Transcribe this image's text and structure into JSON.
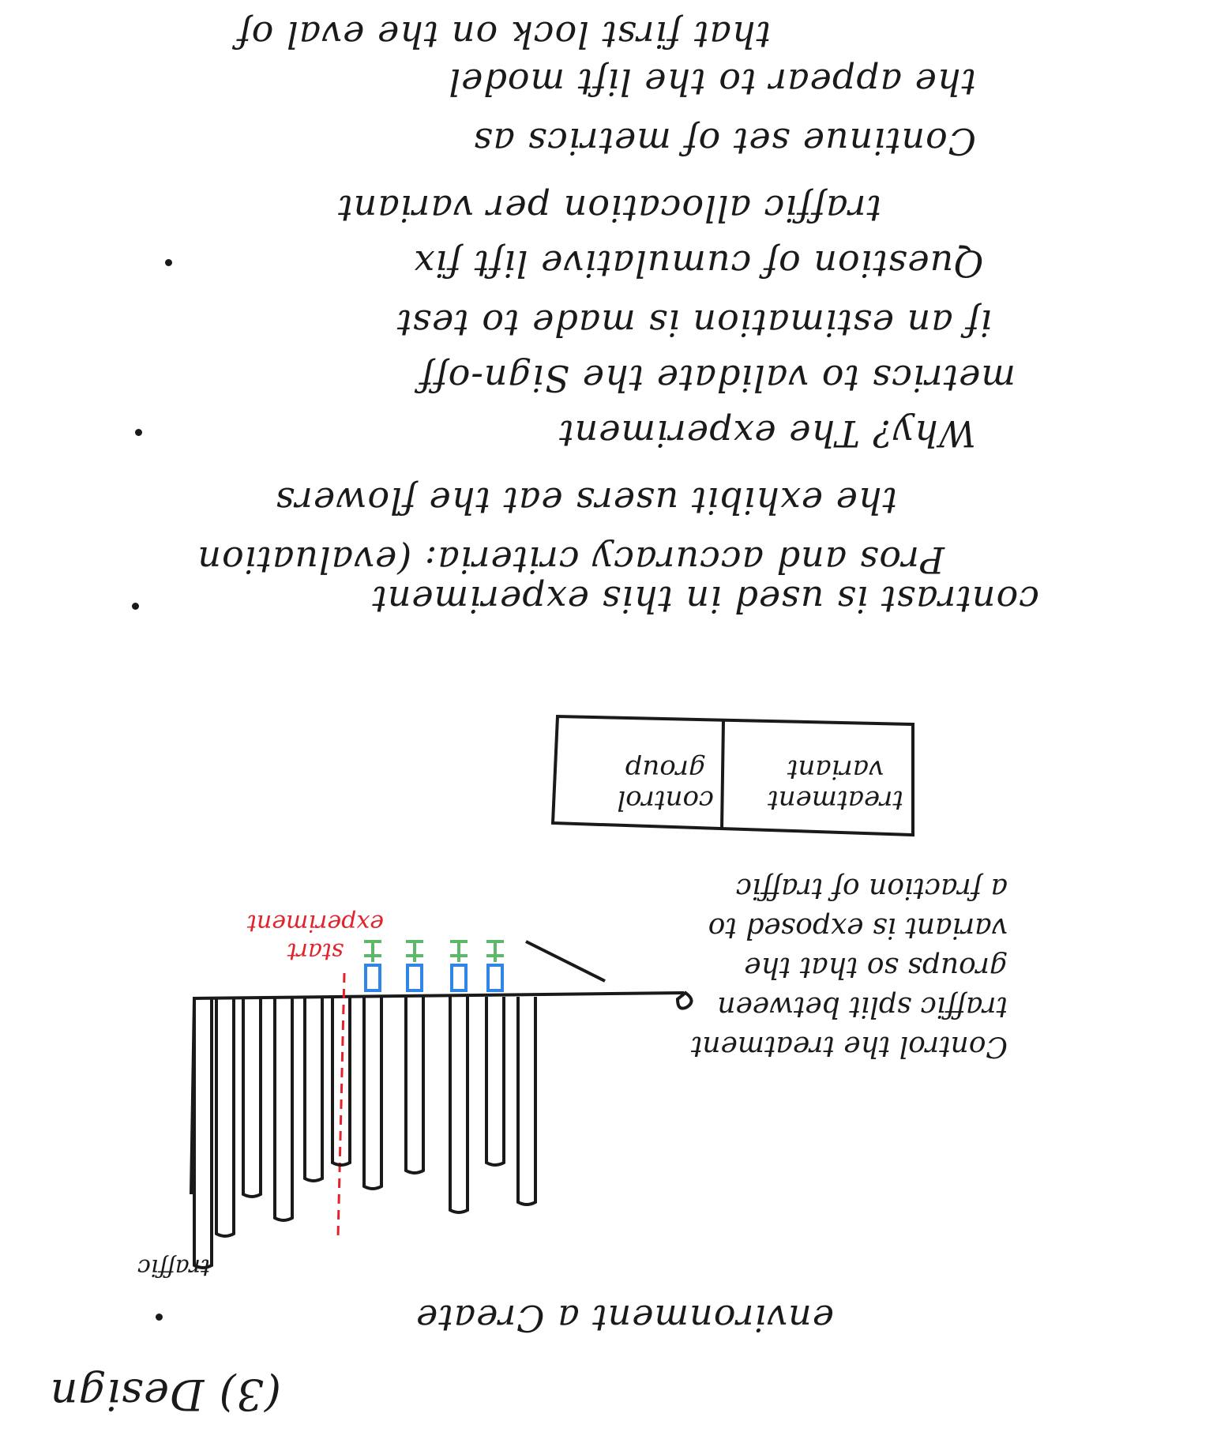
{
  "heading": "(3) Design",
  "lines": [
    "environment  a  Create",
    "contrast  is  used  in  this  experiment",
    "Pros and accuracy criteria: (evaluation",
    "the exhibit users eat the flowers",
    "Why? The experiment",
    "metrics to validate the  Sign-off",
    "if an estimation is made to  test",
    "Question of  cumulative lift  fix",
    "traffic allocation per variant",
    "Continue  set  of  metrics as",
    "the  appear  to  the lift  model",
    "that  first lock on the eval of"
  ],
  "chart": {
    "region_label_red": [
      "start",
      "experiment"
    ],
    "axis_label": "traffic",
    "box": {
      "left_cell": [
        "control",
        "group"
      ],
      "right_cell": [
        "treatment",
        "variant"
      ]
    },
    "annotation": [
      "Control the treatment",
      "traffic split between",
      "groups so that the",
      "variant is exposed to",
      "a fraction of traffic"
    ]
  },
  "colors": {
    "ink": "#1a1a1a",
    "red": "#e3222b",
    "blue": "#2f86e8",
    "green": "#5db86a"
  }
}
